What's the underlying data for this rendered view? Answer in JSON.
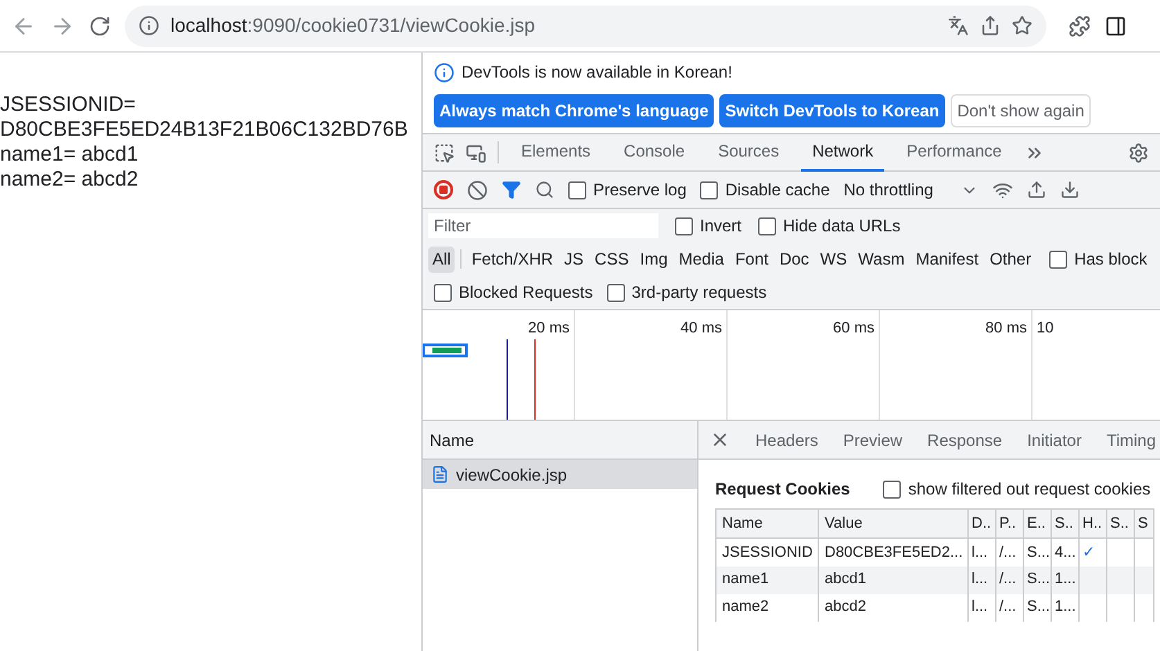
{
  "browser": {
    "url_host": "localhost",
    "url_rest": ":9090/cookie0731/viewCookie.jsp"
  },
  "page": {
    "lines": [
      "JSESSIONID=",
      "D80CBE3FE5ED24B13F21B06C132BD76B",
      "name1= abcd1",
      "name2= abcd2"
    ]
  },
  "devtools": {
    "infobar": {
      "message": "DevTools is now available in Korean!",
      "buttons": [
        {
          "label": "Always match Chrome's language",
          "kind": "primary"
        },
        {
          "label": "Switch DevTools to Korean",
          "kind": "primary"
        },
        {
          "label": "Don't show again",
          "kind": "secondary"
        }
      ]
    },
    "tabs": [
      {
        "label": "Elements",
        "selected": false
      },
      {
        "label": "Console",
        "selected": false
      },
      {
        "label": "Sources",
        "selected": false
      },
      {
        "label": "Network",
        "selected": true
      },
      {
        "label": "Performance",
        "selected": false
      }
    ],
    "toolbar": {
      "preserve_log": {
        "label": "Preserve log",
        "checked": false
      },
      "disable_cache": {
        "label": "Disable cache",
        "checked": false
      },
      "throttling": "No throttling"
    },
    "filter": {
      "placeholder": "Filter",
      "invert": {
        "label": "Invert",
        "checked": false
      },
      "hide_data_urls": {
        "label": "Hide data URLs",
        "checked": false
      }
    },
    "types": [
      {
        "label": "All",
        "selected": true
      },
      {
        "label": "Fetch/XHR",
        "selected": false
      },
      {
        "label": "JS",
        "selected": false
      },
      {
        "label": "CSS",
        "selected": false
      },
      {
        "label": "Img",
        "selected": false
      },
      {
        "label": "Media",
        "selected": false
      },
      {
        "label": "Font",
        "selected": false
      },
      {
        "label": "Doc",
        "selected": false
      },
      {
        "label": "WS",
        "selected": false
      },
      {
        "label": "Wasm",
        "selected": false
      },
      {
        "label": "Manifest",
        "selected": false
      },
      {
        "label": "Other",
        "selected": false
      }
    ],
    "has_blocked": {
      "label": "Has block",
      "checked": false
    },
    "extra_filters": [
      {
        "label": "Blocked Requests",
        "checked": false
      },
      {
        "label": "3rd-party requests",
        "checked": false
      }
    ],
    "overview_ticks": [
      "20 ms",
      "40 ms",
      "60 ms",
      "80 ms",
      "10"
    ],
    "requests": {
      "header": "Name",
      "items": [
        {
          "name": "viewCookie.jsp",
          "selected": true
        }
      ]
    },
    "detail_tabs": [
      {
        "label": "Headers",
        "selected": false
      },
      {
        "label": "Preview",
        "selected": false
      },
      {
        "label": "Response",
        "selected": false
      },
      {
        "label": "Initiator",
        "selected": false
      },
      {
        "label": "Timing",
        "selected": false
      }
    ],
    "cookies": {
      "title": "Request Cookies",
      "show_filtered": {
        "label": "show filtered out request cookies",
        "checked": false
      },
      "columns": [
        "Name",
        "Value",
        "D..",
        "P..",
        "E..",
        "S..",
        "H..",
        "S..",
        "S"
      ],
      "rows": [
        [
          "JSESSIONID",
          "D80CBE3FE5ED2...",
          "l...",
          "/...",
          "S...",
          "4...",
          "✓",
          "",
          ""
        ],
        [
          "name1",
          "abcd1",
          "l...",
          "/...",
          "S...",
          "1...",
          "",
          "",
          ""
        ],
        [
          "name2",
          "abcd2",
          "l...",
          "/...",
          "S...",
          "1...",
          "",
          "",
          ""
        ]
      ]
    }
  }
}
